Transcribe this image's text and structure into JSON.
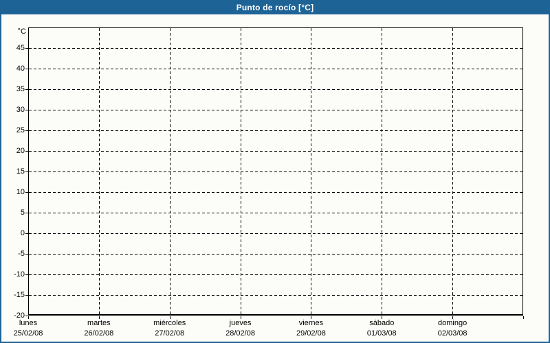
{
  "window": {
    "title_bar": "Punto de rocío [°C]"
  },
  "colors": {
    "frame": "#1e6396",
    "title_text": "#ffffff",
    "background": "#fcfdf9",
    "axis": "#000000"
  },
  "chart_data": {
    "type": "line",
    "title": "Punto de rocío [°C]",
    "y_unit_label": "°C",
    "ylim": [
      -20,
      50
    ],
    "y_tick_step": 5,
    "y_tick_labels": [
      45,
      40,
      35,
      30,
      25,
      20,
      15,
      10,
      5,
      0,
      -5,
      -10,
      -15,
      -20
    ],
    "x_categories": [
      {
        "day": "lunes",
        "date": "25/02/08"
      },
      {
        "day": "martes",
        "date": "26/02/08"
      },
      {
        "day": "miércoles",
        "date": "27/02/08"
      },
      {
        "day": "jueves",
        "date": "28/02/08"
      },
      {
        "day": "viernes",
        "date": "29/02/08"
      },
      {
        "day": "sábado",
        "date": "01/03/08"
      },
      {
        "day": "domingo",
        "date": "02/03/08"
      }
    ],
    "grid": "dashed",
    "legend": "none",
    "series": []
  }
}
